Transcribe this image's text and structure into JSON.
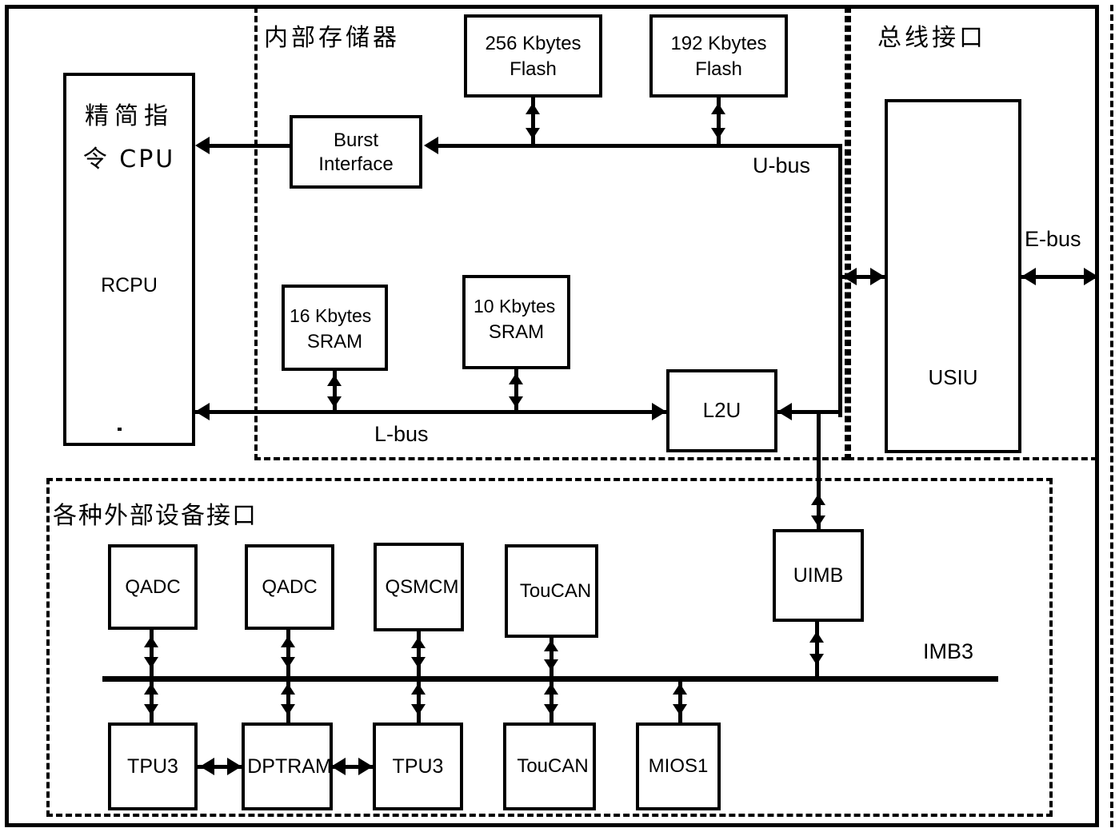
{
  "diagram": {
    "title_regions": {
      "internal_memory": "内部存储器",
      "bus_interface": "总线接口",
      "peripheral_interfaces": "各种外部设备接口"
    },
    "bus_labels": {
      "u_bus": "U-bus",
      "l_bus": "L-bus",
      "e_bus": "E-bus",
      "imb3": "IMB3"
    },
    "blocks": {
      "cpu": {
        "line1": "精简指",
        "line2": "令 CPU",
        "line3": "RCPU"
      },
      "flash_256": {
        "line1": "256 Kbytes",
        "line2": "Flash"
      },
      "flash_192": {
        "line1": "192 Kbytes",
        "line2": "Flash"
      },
      "burst_interface": {
        "line1": "Burst",
        "line2": "Interface"
      },
      "sram_16": {
        "line1": "16 Kbytes",
        "line2": "SRAM"
      },
      "sram_10": {
        "line1": "10 Kbytes",
        "line2": "SRAM"
      },
      "l2u": {
        "label": "L2U"
      },
      "usiu": {
        "label": "USIU"
      },
      "uimb": {
        "label": "UIMB"
      },
      "qadc_1": {
        "label": "QADC"
      },
      "qadc_2": {
        "label": "QADC"
      },
      "qsmcm": {
        "label": "QSMCM"
      },
      "toucan_top": {
        "label": "TouCAN"
      },
      "tpu3_1": {
        "label": "TPU3"
      },
      "dptram": {
        "label": "DPTRAM"
      },
      "tpu3_2": {
        "label": "TPU3"
      },
      "toucan_bottom": {
        "label": "TouCAN"
      },
      "mios1": {
        "label": "MIOS1"
      }
    },
    "colors": {
      "line": "#000000",
      "background": "#ffffff"
    }
  }
}
